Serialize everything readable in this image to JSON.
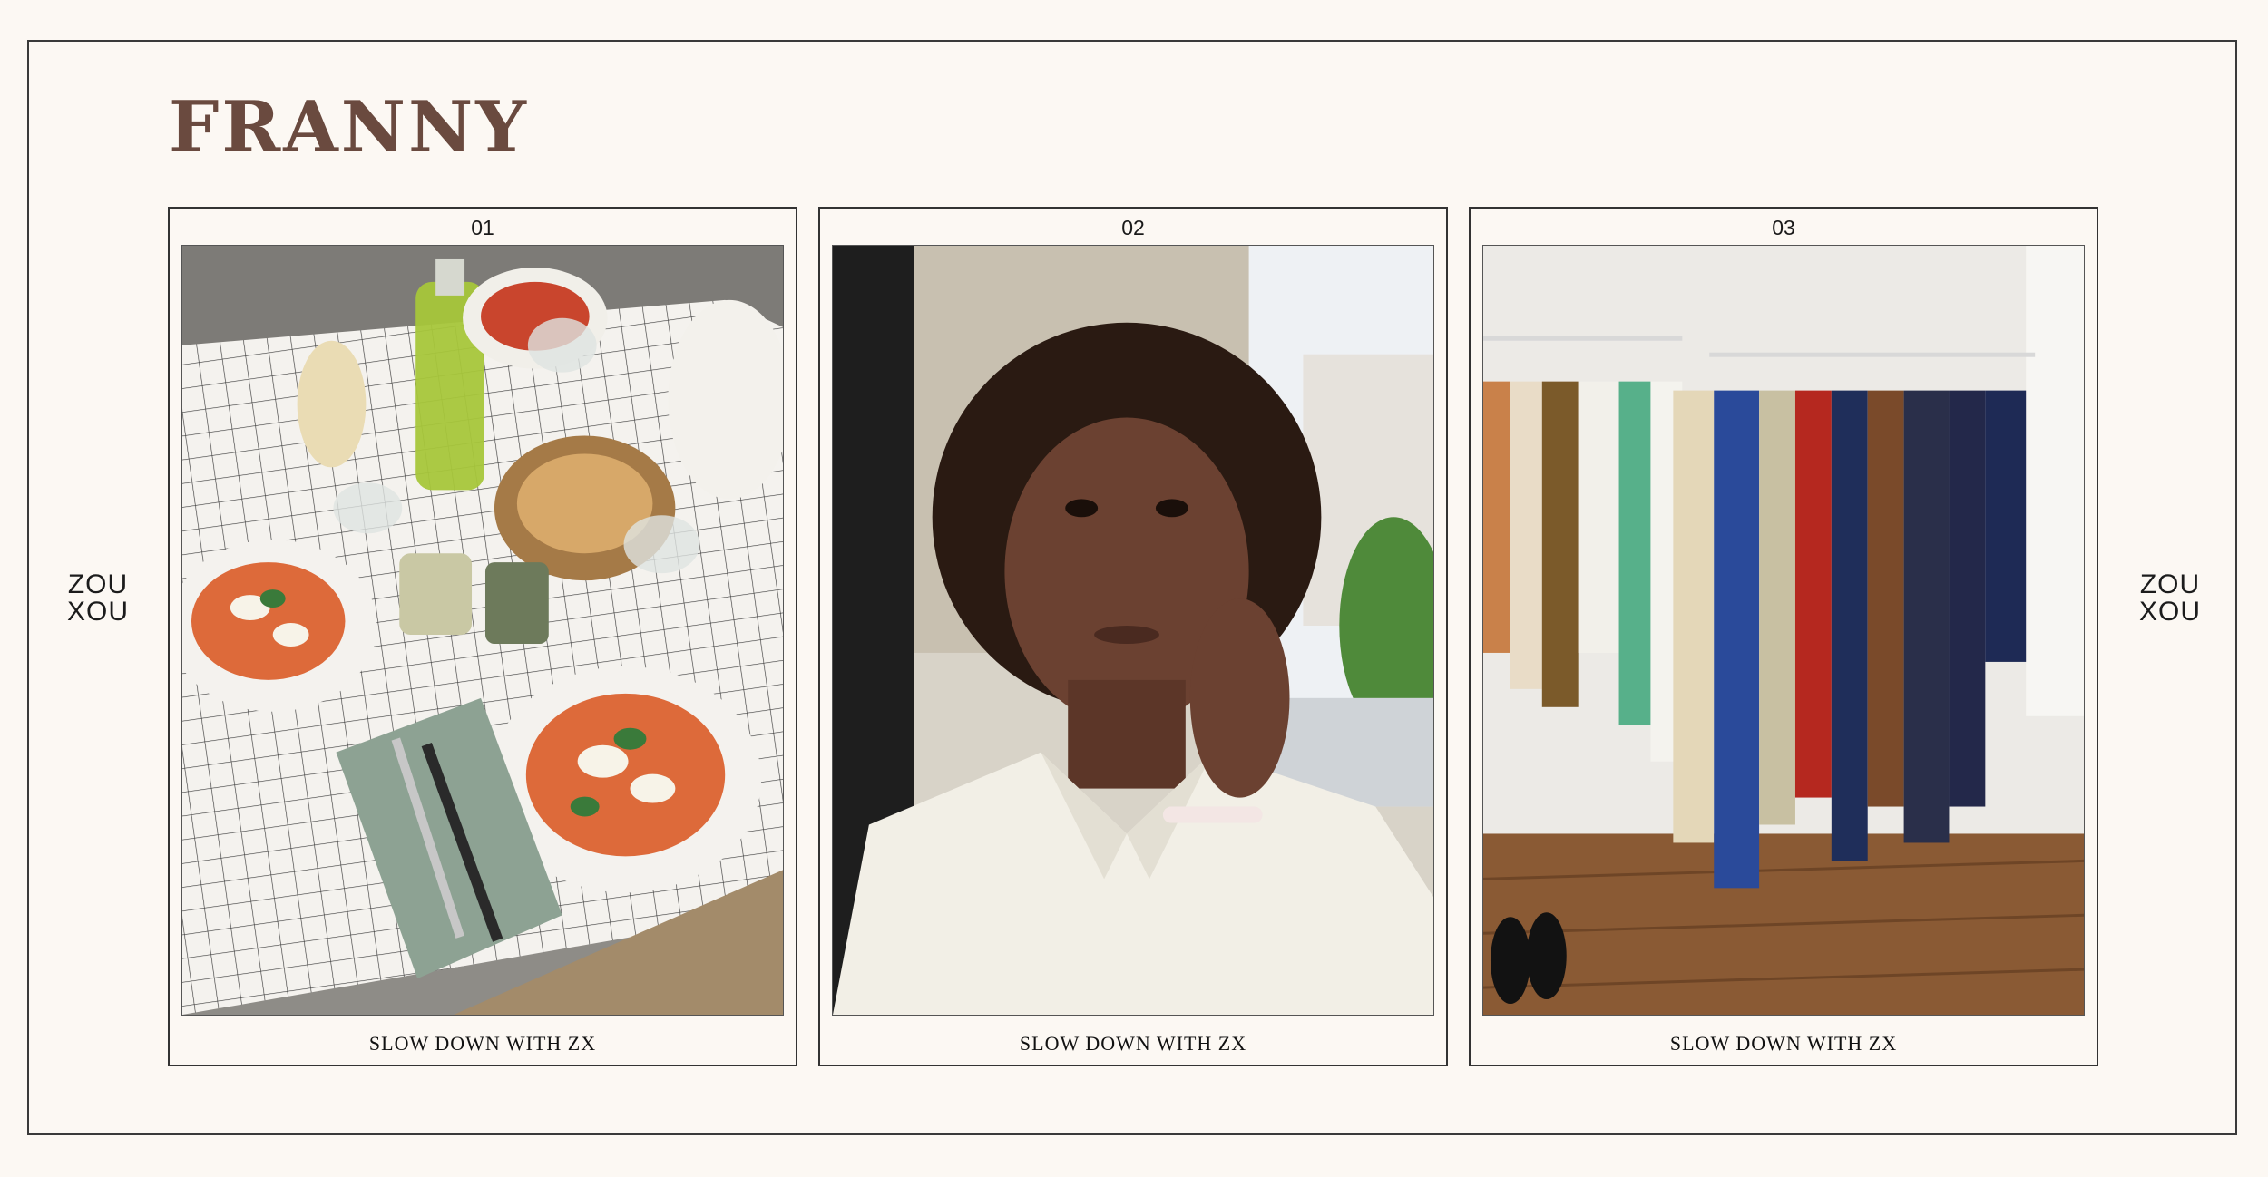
{
  "page": {
    "title": "FRANNY",
    "brand": {
      "line1": "ZOU",
      "line2": "XOU"
    }
  },
  "cards": [
    {
      "number": "01",
      "photo": "food-table-photo",
      "caption": "SLOW DOWN WITH ZX"
    },
    {
      "number": "02",
      "photo": "portrait-photo",
      "caption": "SLOW DOWN WITH ZX"
    },
    {
      "number": "03",
      "photo": "clothing-rack-photo",
      "caption": "SLOW DOWN WITH ZX"
    }
  ],
  "colors": {
    "background": "#fcf8f3",
    "title": "#6a4a3f",
    "border": "#333333"
  }
}
